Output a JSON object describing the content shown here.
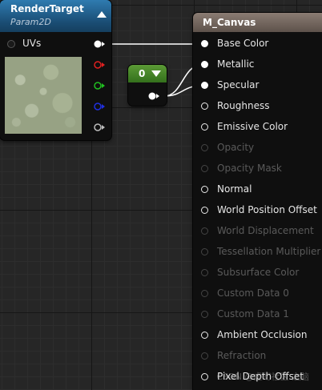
{
  "render_target": {
    "title": "RenderTarget",
    "subtitle": "Param2D",
    "input_label": "UVs",
    "outputs": [
      "white",
      "red",
      "green",
      "blue",
      "gray"
    ]
  },
  "constant": {
    "value": "0"
  },
  "material": {
    "title": "M_Canvas",
    "inputs": [
      {
        "label": "Base Color",
        "state": "connected"
      },
      {
        "label": "Metallic",
        "state": "connected"
      },
      {
        "label": "Specular",
        "state": "connected"
      },
      {
        "label": "Roughness",
        "state": "enabled"
      },
      {
        "label": "Emissive Color",
        "state": "enabled"
      },
      {
        "label": "Opacity",
        "state": "disabled"
      },
      {
        "label": "Opacity Mask",
        "state": "disabled"
      },
      {
        "label": "Normal",
        "state": "enabled"
      },
      {
        "label": "World Position Offset",
        "state": "enabled"
      },
      {
        "label": "World Displacement",
        "state": "disabled"
      },
      {
        "label": "Tessellation Multiplier",
        "state": "disabled"
      },
      {
        "label": "Subsurface Color",
        "state": "disabled"
      },
      {
        "label": "Custom Data 0",
        "state": "disabled"
      },
      {
        "label": "Custom Data 1",
        "state": "disabled"
      },
      {
        "label": "Ambient Occlusion",
        "state": "enabled"
      },
      {
        "label": "Refraction",
        "state": "disabled"
      },
      {
        "label": "Pixel Depth Offset",
        "state": "enabled"
      }
    ]
  },
  "watermark": "CSDN @虚幻社区·之脑",
  "colors": {
    "render_target_header": "#1a4d74",
    "constant_header": "#33701c",
    "material_header": "#6e625a",
    "pin_red": "#e02020",
    "pin_green": "#20c020",
    "pin_blue": "#2030e0"
  }
}
